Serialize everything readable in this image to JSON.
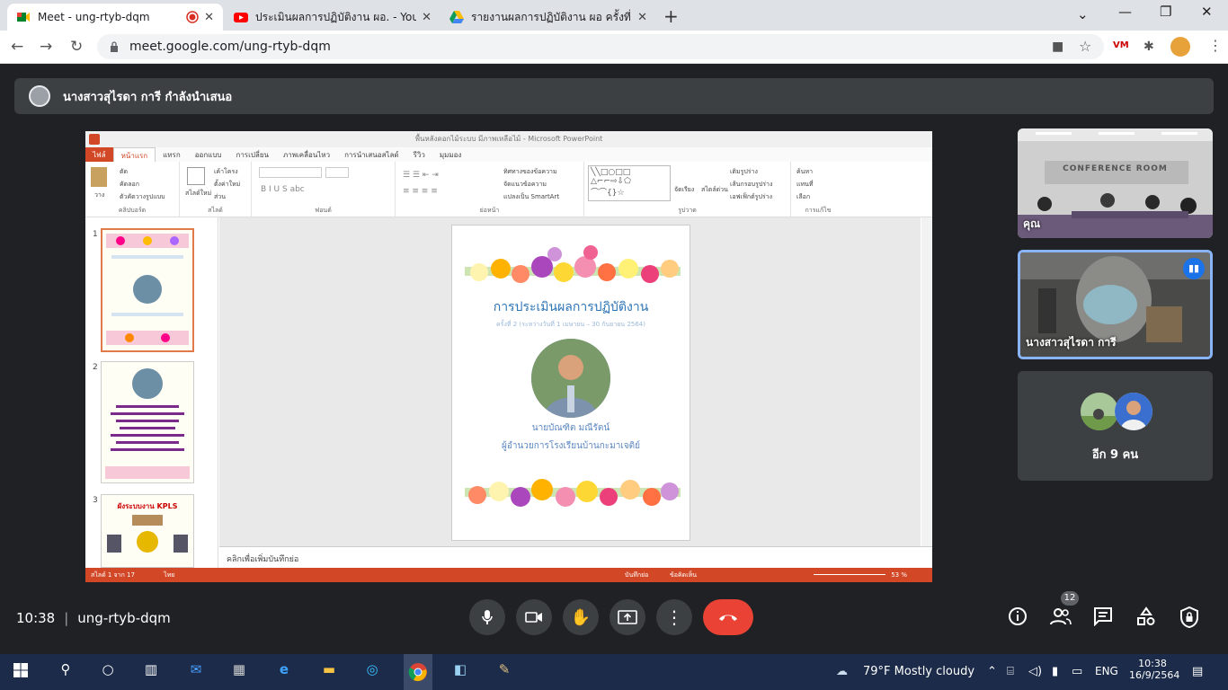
{
  "tabs": [
    {
      "title": "Meet - ung-rtyb-dqm",
      "active": true
    },
    {
      "title": "ประเมินผลการปฏิบัติงาน ผอ. - YouTube"
    },
    {
      "title": "รายงานผลการปฏิบัติงาน ผอ ครั้งที่ 2.m"
    }
  ],
  "address": {
    "url": "meet.google.com/ung-rtyb-dqm"
  },
  "presenter": {
    "text": "นางสาวสุไรดา การี กำลังนำเสนอ"
  },
  "ppt": {
    "window_title": "พื้นหลังดอกไม้ระบบ มีภาพเหลือไม้ - Microsoft PowerPoint",
    "ribbon_tabs": [
      "ไฟล์",
      "หน้าแรก",
      "แทรก",
      "ออกแบบ",
      "การเปลี่ยน",
      "ภาพเคลื่อนไหว",
      "การนำเสนอสไลด์",
      "รีวิว",
      "มุมมอง"
    ],
    "groups": {
      "clipboard": "คลิปบอร์ด",
      "slides": "สไลด์",
      "font": "ฟอนต์",
      "paragraph": "ย่อหน้า",
      "drawing": "รูปวาด",
      "editing": "การแก้ไข"
    },
    "clipboard_items": [
      "วาง",
      "ตัด",
      "คัดลอก",
      "ตัวคัดวางรูปแบบ"
    ],
    "slide_items": [
      "สไลด์ใหม่",
      "เค้าโครง",
      "ตั้งค่าใหม่",
      "ส่วน"
    ],
    "paragraph_items": [
      "ทิศทางของข้อความ",
      "จัดแนวข้อความ",
      "แปลงเป็น SmartArt"
    ],
    "drawing_items": [
      "จัดเรียง",
      "สไตล์ด่วน",
      "เติมรูปร่าง",
      "เส้นกรอบรูปร่าง",
      "เอฟเฟ็กต์รูปร่าง"
    ],
    "editing_items": [
      "ค้นหา",
      "แทนที่",
      "เลือก"
    ],
    "thumb_numbers": [
      "1",
      "2",
      "3"
    ],
    "thumb3_title": "ผังระบบงาน KPLS",
    "slide": {
      "title": "การประเมินผลการปฏิบัติงาน",
      "subtitle": "ครั้งที่ 2 (ระหว่างวันที่ 1 เมษายน – 30 กันยายน 2564)",
      "name": "นายบัณฑิต มณีรัตน์",
      "role": "ผู้อำนวยการโรงเรียนบ้านกะมาเจติย์"
    },
    "notes": "คลิกเพื่อเพิ่มบันทึกย่อ",
    "status_left": "สไลด์ 1 จาก 17",
    "status_lang": "ไทย",
    "status_notes": "บันทึกย่อ",
    "status_comments": "ข้อคิดเห็น",
    "zoom": "53 %"
  },
  "participants": [
    {
      "name": "คุณ",
      "room_sign": "CONFERENCE ROOM"
    },
    {
      "name": "นางสาวสุไรดา การี"
    },
    {
      "label": "อีก 9 คน"
    }
  ],
  "bottom": {
    "time": "10:38",
    "meeting_code": "ung-rtyb-dqm",
    "people_count": "12"
  },
  "taskbar": {
    "weather": "79°F  Mostly cloudy",
    "lang": "ENG",
    "time": "10:38",
    "date": "16/9/2564"
  }
}
